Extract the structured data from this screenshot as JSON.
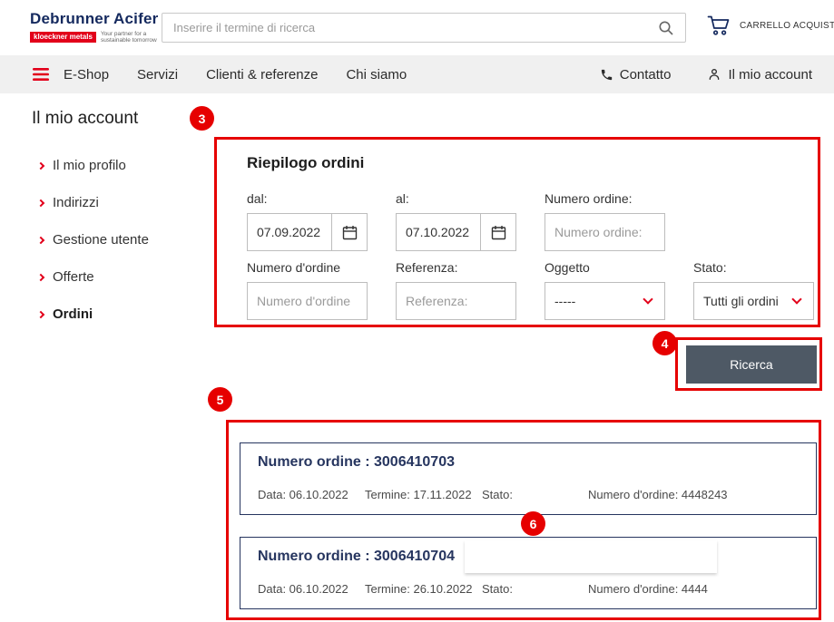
{
  "header": {
    "brand": "Debrunner Acifer",
    "brand_badge": "kloeckner metals",
    "tagline": "Your partner for a sustainable tomorrow",
    "search_placeholder": "Inserire il termine di ricerca",
    "cart_label": "CARRELLO ACQUISTI"
  },
  "nav": {
    "items": [
      "E-Shop",
      "Servizi",
      "Clienti & referenze",
      "Chi siamo"
    ],
    "contact": "Contatto",
    "account": "Il mio account"
  },
  "sidebar": {
    "title": "Il mio account",
    "items": [
      {
        "label": "Il mio profilo",
        "active": false
      },
      {
        "label": "Indirizzi",
        "active": false
      },
      {
        "label": "Gestione utente",
        "active": false
      },
      {
        "label": "Offerte",
        "active": false
      },
      {
        "label": "Ordini",
        "active": true
      }
    ]
  },
  "form": {
    "title": "Riepilogo ordini",
    "dal": {
      "label": "dal:",
      "value": "07.09.2022"
    },
    "al": {
      "label": "al:",
      "value": "07.10.2022"
    },
    "numero_ordine": {
      "label": "Numero ordine:",
      "placeholder": "Numero ordine:"
    },
    "numero_dordine": {
      "label": "Numero d'ordine",
      "placeholder": "Numero d'ordine"
    },
    "referenza": {
      "label": "Referenza:",
      "placeholder": "Referenza:"
    },
    "oggetto": {
      "label": "Oggetto",
      "value": "-----"
    },
    "stato": {
      "label": "Stato:",
      "value": "Tutti gli ordini"
    },
    "submit": "Ricerca"
  },
  "orders": [
    {
      "title": "Numero ordine : 3006410703",
      "data": "Data: 06.10.2022",
      "termine": "Termine: 17.11.2022",
      "stato": "Stato:",
      "numero": "Numero d'ordine: 4448243"
    },
    {
      "title": "Numero ordine : 3006410704",
      "data": "Data: 06.10.2022",
      "termine": "Termine: 26.10.2022",
      "stato": "Stato:",
      "numero": "Numero d'ordine: 4444"
    }
  ],
  "annotations": {
    "step3": "3",
    "step4": "4",
    "step5": "5",
    "step6": "6"
  },
  "colors": {
    "brand_navy": "#14295e",
    "brand_red": "#e2001a",
    "annotation_red": "#e60000",
    "button_slate": "#4e5965",
    "nav_bg": "#f0f0f0",
    "card_border_navy": "#26355f"
  }
}
